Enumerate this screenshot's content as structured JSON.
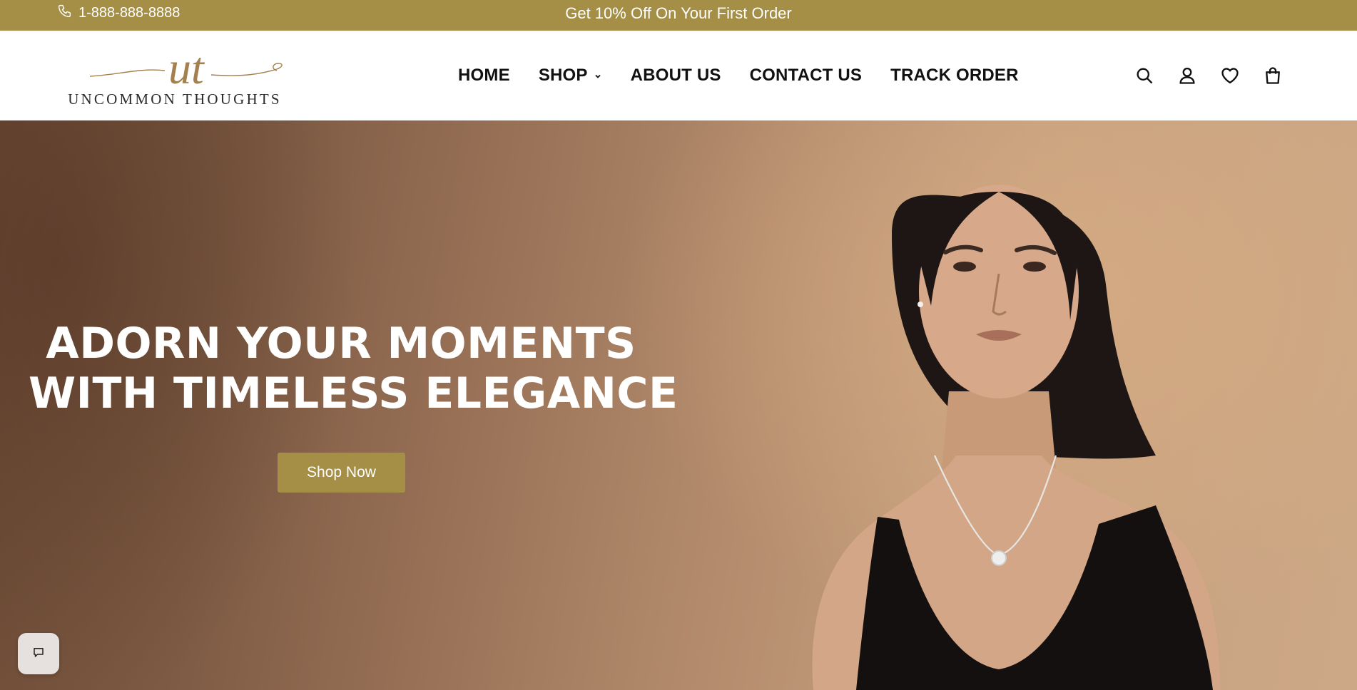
{
  "announcement": {
    "phone": "1-888-888-8888",
    "promo": "Get 10% Off On Your First Order"
  },
  "brand": {
    "monogram": "ut",
    "name": "UNCOMMON THOUGHTS"
  },
  "nav": {
    "items": [
      {
        "label": "HOME"
      },
      {
        "label": "SHOP"
      },
      {
        "label": "ABOUT US"
      },
      {
        "label": "CONTACT US"
      },
      {
        "label": "TRACK ORDER"
      }
    ]
  },
  "header_icons": [
    "search-icon",
    "account-icon",
    "wishlist-heart-icon",
    "cart-bag-icon"
  ],
  "hero": {
    "title_line1": "ADORN YOUR MOMENTS",
    "title_line2": "WITH TIMELESS ELEGANCE",
    "cta_label": "Shop Now"
  },
  "colors": {
    "accent": "#a58e46",
    "text": "#111111",
    "white": "#ffffff"
  }
}
